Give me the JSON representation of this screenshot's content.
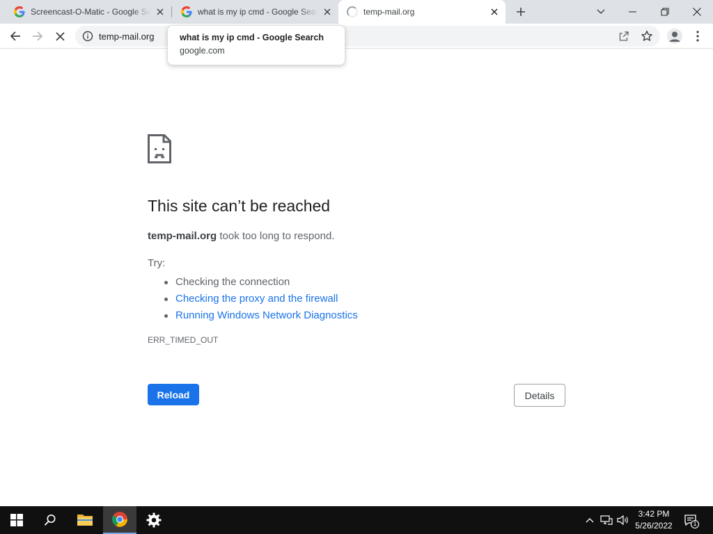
{
  "browser": {
    "tabs": [
      {
        "title": "Screencast-O-Matic - Google Search",
        "favicon": "google-g-icon",
        "active": false
      },
      {
        "title": "what is my ip cmd - Google Search",
        "favicon": "google-g-icon",
        "active": false
      },
      {
        "title": "temp-mail.org",
        "favicon": "loading-spinner-icon",
        "active": true
      }
    ],
    "omnibox": {
      "url": "temp-mail.org"
    },
    "hover_card": {
      "title": "what is my ip cmd - Google Search",
      "domain": "google.com"
    }
  },
  "error_page": {
    "heading": "This site can’t be reached",
    "host": "temp-mail.org",
    "message_rest": " took too long to respond.",
    "try_label": "Try:",
    "suggestions": [
      {
        "text": "Checking the connection",
        "link": false
      },
      {
        "text": "Checking the proxy and the firewall",
        "link": true
      },
      {
        "text": "Running Windows Network Diagnostics",
        "link": true
      }
    ],
    "error_code": "ERR_TIMED_OUT",
    "reload_label": "Reload",
    "details_label": "Details"
  },
  "taskbar": {
    "clock_time": "3:42 PM",
    "clock_date": "5/26/2022",
    "notification_count": "1"
  },
  "colors": {
    "accent_blue": "#1a73e8",
    "tabstrip_bg": "#dee1e6",
    "taskbar_bg": "#101010"
  }
}
